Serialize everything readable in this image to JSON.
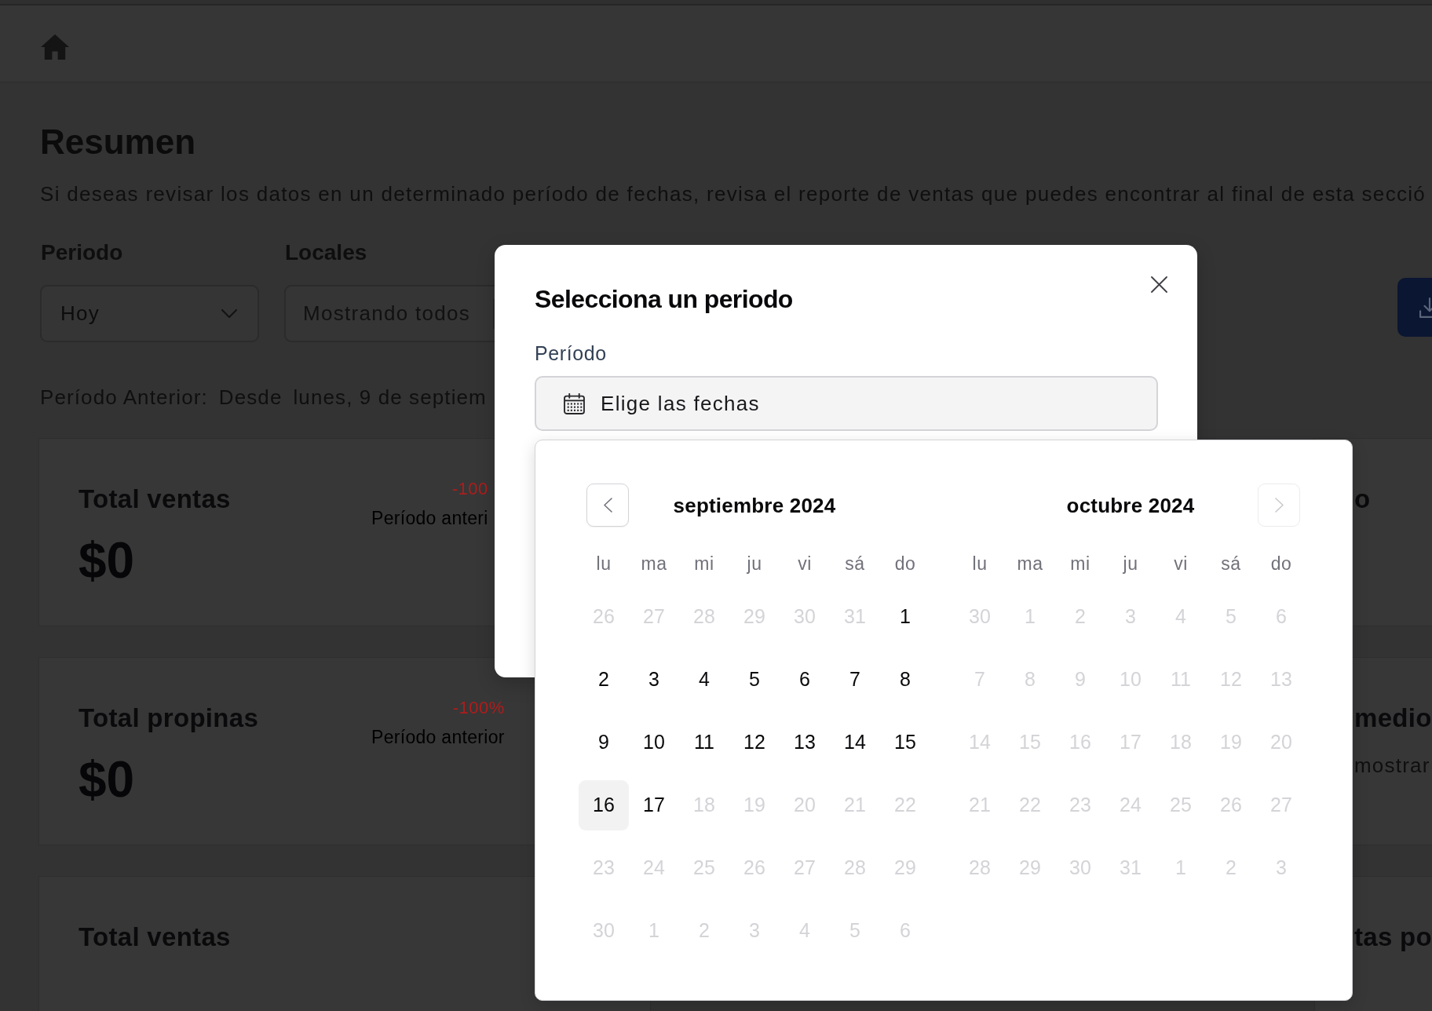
{
  "page": {
    "title": "Resumen",
    "subtitle": "Si deseas revisar los datos en un determinado período de fechas, revisa el reporte de ventas que puedes encontrar al final de esta secció"
  },
  "filters": [
    {
      "kind": "select",
      "label": "Periodo",
      "value": "Hoy"
    },
    {
      "kind": "multiselect",
      "label": "Locales",
      "placeholder": "Mostrando todos"
    }
  ],
  "previous_period": {
    "label": "Período Anterior:",
    "from_label": "Desde",
    "from_date": "lunes, 9 de septiem"
  },
  "stat_cards_left": [
    {
      "title": "Total ventas",
      "value": "$0",
      "change": "-100",
      "change_caption": "Período anteri"
    },
    {
      "title": "Total propinas",
      "value": "$0",
      "change": "-100%",
      "change_caption": "Período anterior"
    },
    {
      "title": "Total ventas"
    }
  ],
  "stat_cards_right": [
    {
      "title": "o"
    },
    {
      "title": "medio",
      "subtitle": "mostrar"
    },
    {
      "title": "tas po"
    }
  ],
  "dialog": {
    "title": "Selecciona un periodo",
    "field_label": "Período",
    "date_field": {
      "label": "Elige las fechas"
    }
  },
  "calendar": {
    "months": [
      {
        "title": "septiembre 2024",
        "nav": {
          "kind": "prev",
          "disabled": false
        },
        "weekdays": [
          "lu",
          "ma",
          "mi",
          "ju",
          "vi",
          "sá",
          "do"
        ],
        "weeks": [
          [
            {
              "label": "26",
              "disabled": true,
              "today": false
            },
            {
              "label": "27",
              "disabled": true,
              "today": false
            },
            {
              "label": "28",
              "disabled": true,
              "today": false
            },
            {
              "label": "29",
              "disabled": true,
              "today": false
            },
            {
              "label": "30",
              "disabled": true,
              "today": false
            },
            {
              "label": "31",
              "disabled": true,
              "today": false
            },
            {
              "label": "1",
              "disabled": false,
              "today": false
            }
          ],
          [
            {
              "label": "2",
              "disabled": false,
              "today": false
            },
            {
              "label": "3",
              "disabled": false,
              "today": false
            },
            {
              "label": "4",
              "disabled": false,
              "today": false
            },
            {
              "label": "5",
              "disabled": false,
              "today": false
            },
            {
              "label": "6",
              "disabled": false,
              "today": false
            },
            {
              "label": "7",
              "disabled": false,
              "today": false
            },
            {
              "label": "8",
              "disabled": false,
              "today": false
            }
          ],
          [
            {
              "label": "9",
              "disabled": false,
              "today": false
            },
            {
              "label": "10",
              "disabled": false,
              "today": false
            },
            {
              "label": "11",
              "disabled": false,
              "today": false
            },
            {
              "label": "12",
              "disabled": false,
              "today": false
            },
            {
              "label": "13",
              "disabled": false,
              "today": false
            },
            {
              "label": "14",
              "disabled": false,
              "today": false
            },
            {
              "label": "15",
              "disabled": false,
              "today": false
            }
          ],
          [
            {
              "label": "16",
              "disabled": false,
              "today": true
            },
            {
              "label": "17",
              "disabled": false,
              "today": false
            },
            {
              "label": "18",
              "disabled": true,
              "today": false
            },
            {
              "label": "19",
              "disabled": true,
              "today": false
            },
            {
              "label": "20",
              "disabled": true,
              "today": false
            },
            {
              "label": "21",
              "disabled": true,
              "today": false
            },
            {
              "label": "22",
              "disabled": true,
              "today": false
            }
          ],
          [
            {
              "label": "23",
              "disabled": true,
              "today": false
            },
            {
              "label": "24",
              "disabled": true,
              "today": false
            },
            {
              "label": "25",
              "disabled": true,
              "today": false
            },
            {
              "label": "26",
              "disabled": true,
              "today": false
            },
            {
              "label": "27",
              "disabled": true,
              "today": false
            },
            {
              "label": "28",
              "disabled": true,
              "today": false
            },
            {
              "label": "29",
              "disabled": true,
              "today": false
            }
          ],
          [
            {
              "label": "30",
              "disabled": true,
              "today": false
            },
            {
              "label": "1",
              "disabled": true,
              "today": false
            },
            {
              "label": "2",
              "disabled": true,
              "today": false
            },
            {
              "label": "3",
              "disabled": true,
              "today": false
            },
            {
              "label": "4",
              "disabled": true,
              "today": false
            },
            {
              "label": "5",
              "disabled": true,
              "today": false
            },
            {
              "label": "6",
              "disabled": true,
              "today": false
            }
          ]
        ]
      },
      {
        "title": "octubre 2024",
        "nav": {
          "kind": "next",
          "disabled": true
        },
        "weekdays": [
          "lu",
          "ma",
          "mi",
          "ju",
          "vi",
          "sá",
          "do"
        ],
        "weeks": [
          [
            {
              "label": "30",
              "disabled": true,
              "today": false
            },
            {
              "label": "1",
              "disabled": true,
              "today": false
            },
            {
              "label": "2",
              "disabled": true,
              "today": false
            },
            {
              "label": "3",
              "disabled": true,
              "today": false
            },
            {
              "label": "4",
              "disabled": true,
              "today": false
            },
            {
              "label": "5",
              "disabled": true,
              "today": false
            },
            {
              "label": "6",
              "disabled": true,
              "today": false
            }
          ],
          [
            {
              "label": "7",
              "disabled": true,
              "today": false
            },
            {
              "label": "8",
              "disabled": true,
              "today": false
            },
            {
              "label": "9",
              "disabled": true,
              "today": false
            },
            {
              "label": "10",
              "disabled": true,
              "today": false
            },
            {
              "label": "11",
              "disabled": true,
              "today": false
            },
            {
              "label": "12",
              "disabled": true,
              "today": false
            },
            {
              "label": "13",
              "disabled": true,
              "today": false
            }
          ],
          [
            {
              "label": "14",
              "disabled": true,
              "today": false
            },
            {
              "label": "15",
              "disabled": true,
              "today": false
            },
            {
              "label": "16",
              "disabled": true,
              "today": false
            },
            {
              "label": "17",
              "disabled": true,
              "today": false
            },
            {
              "label": "18",
              "disabled": true,
              "today": false
            },
            {
              "label": "19",
              "disabled": true,
              "today": false
            },
            {
              "label": "20",
              "disabled": true,
              "today": false
            }
          ],
          [
            {
              "label": "21",
              "disabled": true,
              "today": false
            },
            {
              "label": "22",
              "disabled": true,
              "today": false
            },
            {
              "label": "23",
              "disabled": true,
              "today": false
            },
            {
              "label": "24",
              "disabled": true,
              "today": false
            },
            {
              "label": "25",
              "disabled": true,
              "today": false
            },
            {
              "label": "26",
              "disabled": true,
              "today": false
            },
            {
              "label": "27",
              "disabled": true,
              "today": false
            }
          ],
          [
            {
              "label": "28",
              "disabled": true,
              "today": false
            },
            {
              "label": "29",
              "disabled": true,
              "today": false
            },
            {
              "label": "30",
              "disabled": true,
              "today": false
            },
            {
              "label": "31",
              "disabled": true,
              "today": false
            },
            {
              "label": "1",
              "disabled": true,
              "today": false
            },
            {
              "label": "2",
              "disabled": true,
              "today": false
            },
            {
              "label": "3",
              "disabled": true,
              "today": false
            }
          ]
        ]
      }
    ]
  }
}
